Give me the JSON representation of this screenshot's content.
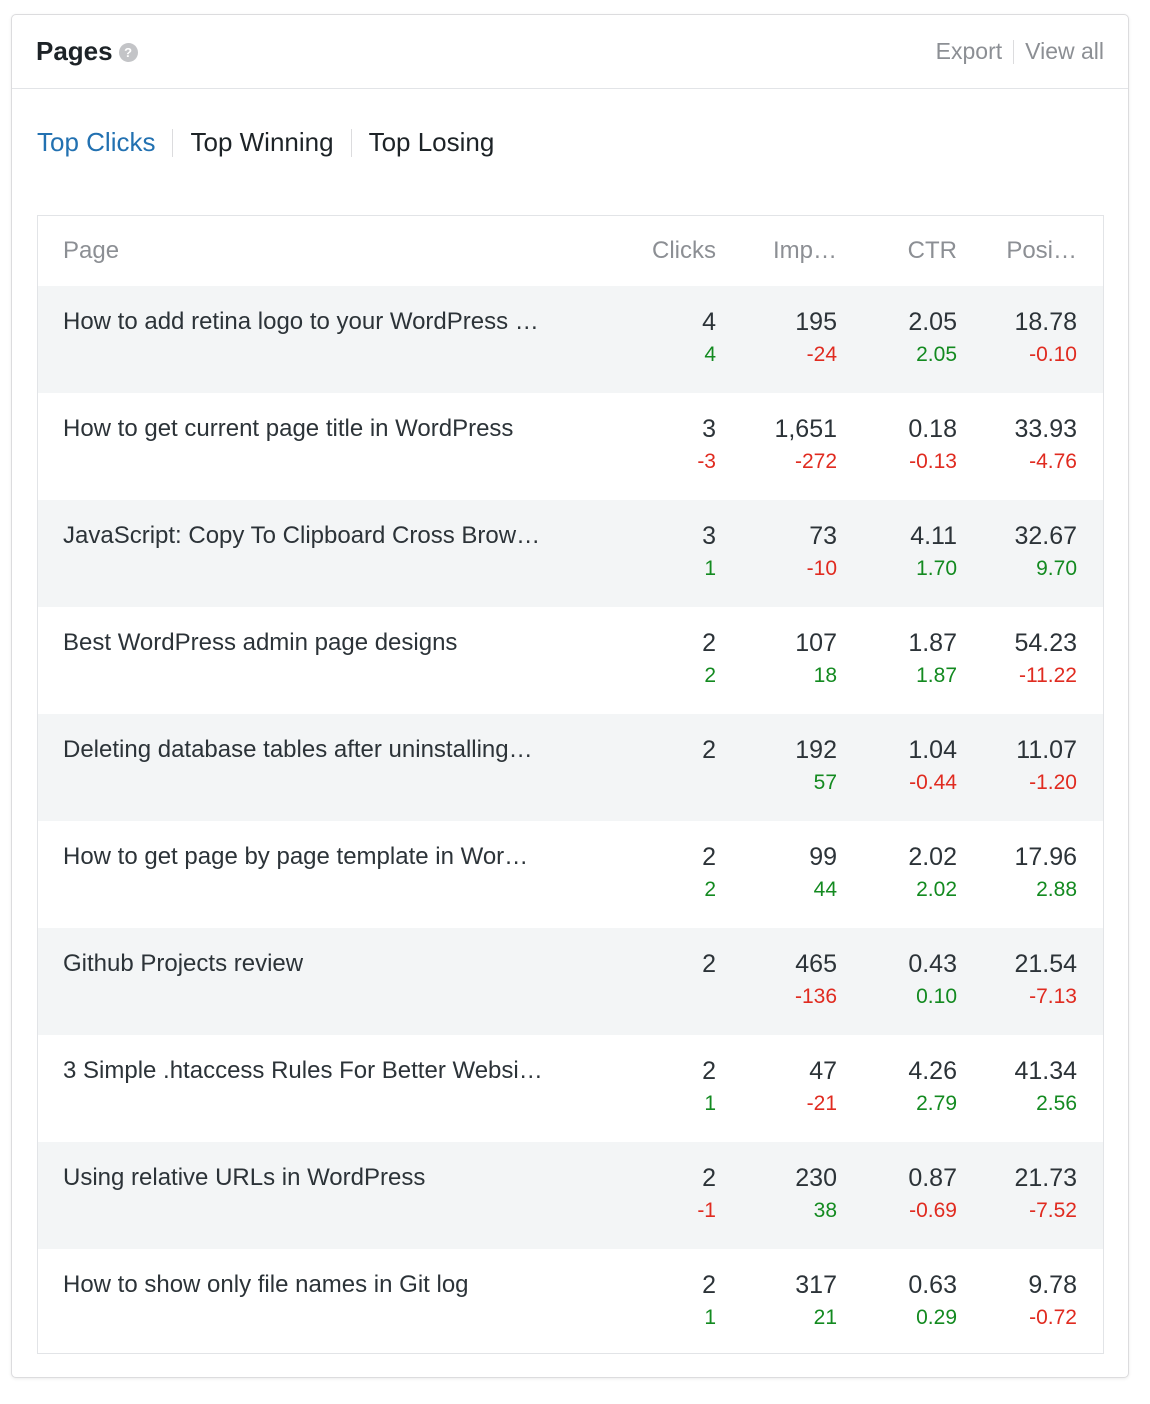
{
  "header": {
    "title": "Pages",
    "help_icon": "question-mark-circle",
    "export_label": "Export",
    "view_all_label": "View all"
  },
  "tabs": [
    {
      "label": "Top Clicks",
      "active": true
    },
    {
      "label": "Top Winning",
      "active": false
    },
    {
      "label": "Top Losing",
      "active": false
    }
  ],
  "colors": {
    "accent": "#2271b1",
    "positive": "#138a20",
    "negative": "#e02b20",
    "row_shade": "#f3f5f6"
  },
  "table": {
    "columns": [
      "Page",
      "Clicks",
      "Imp…",
      "CTR",
      "Posi…"
    ],
    "rows": [
      {
        "page": "How to add retina logo to your WordPress …",
        "clicks": "4",
        "clicks_delta": "4",
        "imp": "195",
        "imp_delta": "-24",
        "ctr": "2.05",
        "ctr_delta": "2.05",
        "pos": "18.78",
        "pos_delta": "-0.10"
      },
      {
        "page": "How to get current page title in WordPress",
        "clicks": "3",
        "clicks_delta": "-3",
        "imp": "1,651",
        "imp_delta": "-272",
        "ctr": "0.18",
        "ctr_delta": "-0.13",
        "pos": "33.93",
        "pos_delta": "-4.76"
      },
      {
        "page": "JavaScript: Copy To Clipboard Cross Brow…",
        "clicks": "3",
        "clicks_delta": "1",
        "imp": "73",
        "imp_delta": "-10",
        "ctr": "4.11",
        "ctr_delta": "1.70",
        "pos": "32.67",
        "pos_delta": "9.70"
      },
      {
        "page": "Best WordPress admin page designs",
        "clicks": "2",
        "clicks_delta": "2",
        "imp": "107",
        "imp_delta": "18",
        "ctr": "1.87",
        "ctr_delta": "1.87",
        "pos": "54.23",
        "pos_delta": "-11.22"
      },
      {
        "page": "Deleting database tables after uninstalling…",
        "clicks": "2",
        "clicks_delta": "",
        "imp": "192",
        "imp_delta": "57",
        "ctr": "1.04",
        "ctr_delta": "-0.44",
        "pos": "11.07",
        "pos_delta": "-1.20"
      },
      {
        "page": "How to get page by page template in Wor…",
        "clicks": "2",
        "clicks_delta": "2",
        "imp": "99",
        "imp_delta": "44",
        "ctr": "2.02",
        "ctr_delta": "2.02",
        "pos": "17.96",
        "pos_delta": "2.88"
      },
      {
        "page": "Github Projects review",
        "clicks": "2",
        "clicks_delta": "",
        "imp": "465",
        "imp_delta": "-136",
        "ctr": "0.43",
        "ctr_delta": "0.10",
        "pos": "21.54",
        "pos_delta": "-7.13"
      },
      {
        "page": "3 Simple .htaccess Rules For Better Websi…",
        "clicks": "2",
        "clicks_delta": "1",
        "imp": "47",
        "imp_delta": "-21",
        "ctr": "4.26",
        "ctr_delta": "2.79",
        "pos": "41.34",
        "pos_delta": "2.56"
      },
      {
        "page": "Using relative URLs in WordPress",
        "clicks": "2",
        "clicks_delta": "-1",
        "imp": "230",
        "imp_delta": "38",
        "ctr": "0.87",
        "ctr_delta": "-0.69",
        "pos": "21.73",
        "pos_delta": "-7.52"
      },
      {
        "page": "How to show only file names in Git log",
        "clicks": "2",
        "clicks_delta": "1",
        "imp": "317",
        "imp_delta": "21",
        "ctr": "0.63",
        "ctr_delta": "0.29",
        "pos": "9.78",
        "pos_delta": "-0.72"
      }
    ]
  }
}
